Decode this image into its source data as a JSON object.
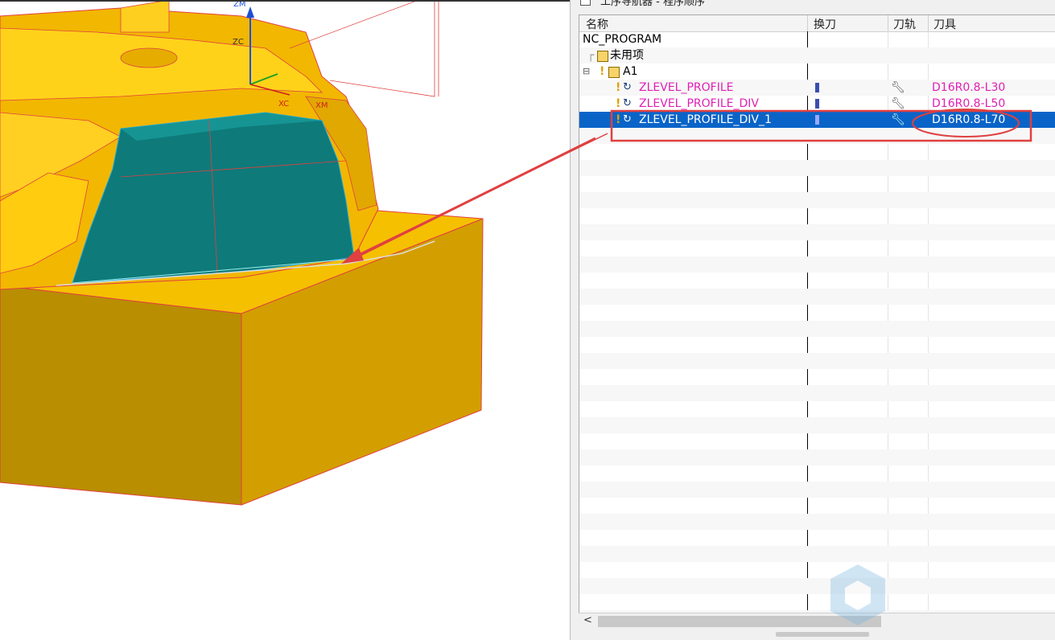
{
  "viewport": {
    "axis_labels": {
      "zm": "ZM",
      "zc": "ZC",
      "xc": "XC",
      "xm": "XM"
    }
  },
  "navigator": {
    "title": "工序导航器 - 程序顺序",
    "columns": {
      "name": "名称",
      "tool_change": "换刀",
      "path": "刀轨",
      "tool": "刀具"
    },
    "rows": [
      {
        "name": "NC_PROGRAM",
        "tool": ""
      },
      {
        "name": "未用项",
        "tool": ""
      },
      {
        "name": "A1",
        "tool": ""
      },
      {
        "name": "ZLEVEL_PROFILE",
        "tool": "D16R0.8-L30"
      },
      {
        "name": "ZLEVEL_PROFILE_DIV",
        "tool": "D16R0.8-L50"
      },
      {
        "name": "ZLEVEL_PROFILE_DIV_1",
        "tool": "D16R0.8-L70"
      }
    ],
    "scroll_left": "<"
  },
  "colors": {
    "part_yellow": "#f2b700",
    "part_dark": "#b98e00",
    "surface_teal": "#0e7a7a",
    "selection_blue": "#0a64c8",
    "op_pink": "#e020b4",
    "annotation_red": "#e04040"
  }
}
